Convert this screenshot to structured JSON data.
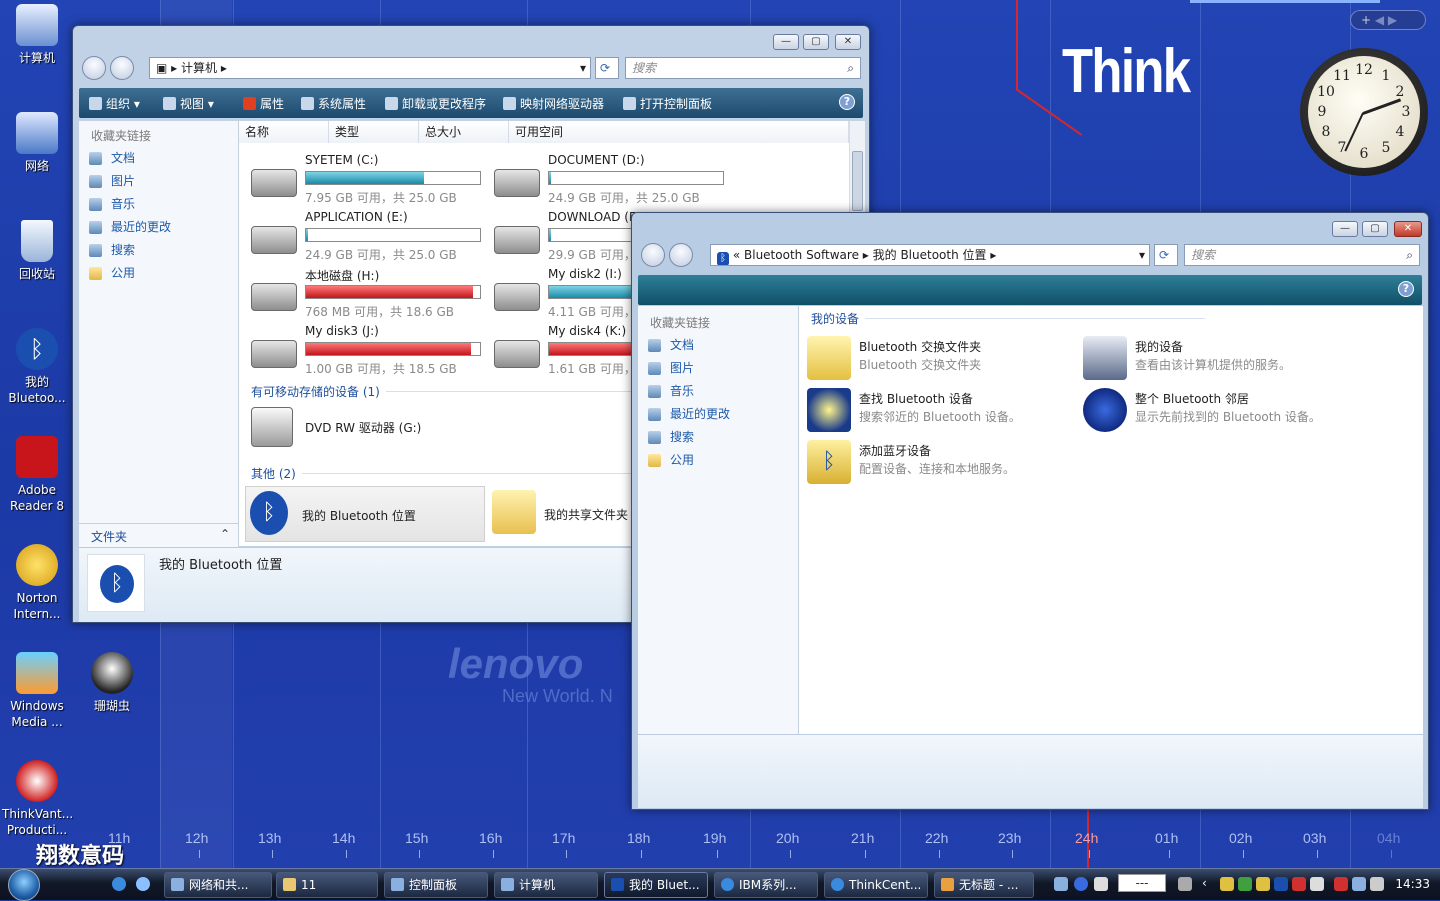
{
  "desktop": {
    "icons": [
      {
        "label": "计算机"
      },
      {
        "label": "网络"
      },
      {
        "label": "回收站"
      },
      {
        "label": "我的 Bluetoo..."
      },
      {
        "label": "Adobe Reader 8"
      },
      {
        "label": "Norton Intern..."
      },
      {
        "label": "Windows Media ..."
      },
      {
        "label": "珊瑚虫"
      },
      {
        "label": "ThinkVant... Producti..."
      }
    ],
    "brand": "Think",
    "wallpaper_logo": "lenovo",
    "wallpaper_slogan": "New World. N",
    "hours": [
      "11h",
      "12h",
      "13h",
      "14h",
      "15h",
      "16h",
      "17h",
      "18h",
      "19h",
      "20h",
      "21h",
      "22h",
      "23h",
      "24h",
      "01h",
      "02h",
      "03h",
      "04h"
    ],
    "clock_numbers": [
      "12",
      "1",
      "2",
      "3",
      "4",
      "5",
      "6",
      "7",
      "8",
      "9",
      "10",
      "11"
    ],
    "gadget_add": "+",
    "watermark": "翔数意码"
  },
  "computer_window": {
    "breadcrumb": "计算机",
    "search_placeholder": "搜索",
    "toolbar": {
      "organize": "组织",
      "views": "视图",
      "properties": "属性",
      "system_properties": "系统属性",
      "uninstall": "卸载或更改程序",
      "map_drive": "映射网络驱动器",
      "control_panel": "打开控制面板"
    },
    "nav": {
      "heading": "收藏夹链接",
      "items": [
        "文档",
        "图片",
        "音乐",
        "最近的更改",
        "搜索",
        "公用"
      ],
      "folders_label": "文件夹"
    },
    "columns": [
      "名称",
      "类型",
      "总大小",
      "可用空间"
    ],
    "drives": [
      {
        "name": "SYETEM (C:)",
        "stats": "7.95 GB 可用，共 25.0 GB",
        "used": 0.68,
        "color": "blue"
      },
      {
        "name": "DOCUMENT (D:)",
        "stats": "24.9 GB 可用，共 25.0 GB",
        "used": 0.01,
        "color": "blue"
      },
      {
        "name": "APPLICATION (E:)",
        "stats": "24.9 GB 可用，共 25.0 GB",
        "used": 0.01,
        "color": "blue"
      },
      {
        "name": "DOWNLOAD (F",
        "stats": "29.9 GB 可用，",
        "used": 0.01,
        "color": "blue"
      },
      {
        "name": "本地磁盘 (H:)",
        "stats": "768 MB 可用，共 18.6 GB",
        "used": 0.96,
        "color": "red"
      },
      {
        "name": "My disk2 (I:)",
        "stats": "4.11 GB 可用，",
        "used": 0.78,
        "color": "blue"
      },
      {
        "name": "My disk3 (J:)",
        "stats": "1.00 GB 可用，共 18.5 GB",
        "used": 0.95,
        "color": "red"
      },
      {
        "name": "My disk4 (K:)",
        "stats": "1.61 GB 可用，",
        "used": 0.92,
        "color": "red"
      }
    ],
    "removable_group": "有可移动存储的设备 (1)",
    "dvd": "DVD RW 驱动器 (G:)",
    "other_group": "其他 (2)",
    "other_items": [
      "我的 Bluetooth 位置",
      "我的共享文件夹"
    ],
    "details_name": "我的 Bluetooth 位置"
  },
  "bt_window": {
    "breadcrumb": [
      "Bluetooth Software",
      "我的 Bluetooth 位置"
    ],
    "breadcrumb_prefix": "«",
    "search_placeholder": "搜索",
    "nav": {
      "heading": "收藏夹链接",
      "items": [
        "文档",
        "图片",
        "音乐",
        "最近的更改",
        "搜索",
        "公用"
      ]
    },
    "group": "我的设备",
    "tiles": [
      {
        "title": "Bluetooth 交换文件夹",
        "desc": "Bluetooth 交换文件夹"
      },
      {
        "title": "我的设备",
        "desc": "查看由该计算机提供的服务。"
      },
      {
        "title": "查找 Bluetooth 设备",
        "desc": "搜索邻近的 Bluetooth 设备。"
      },
      {
        "title": "整个 Bluetooth 邻居",
        "desc": "显示先前找到的 Bluetooth 设备。"
      },
      {
        "title": "添加蓝牙设备",
        "desc": "配置设备、连接和本地服务。"
      }
    ]
  },
  "taskbar": {
    "buttons": [
      "网络和共...",
      "11",
      "控制面板",
      "计算机",
      "我的 Bluet...",
      "IBM系列...",
      "ThinkCent...",
      "无标题 - ..."
    ],
    "time": "14:33"
  },
  "colors": {
    "toolbar": "#1b4a6e",
    "link": "#1e5aa8",
    "diskred": "#c2151b",
    "diskblue": "#1a8aa8"
  }
}
